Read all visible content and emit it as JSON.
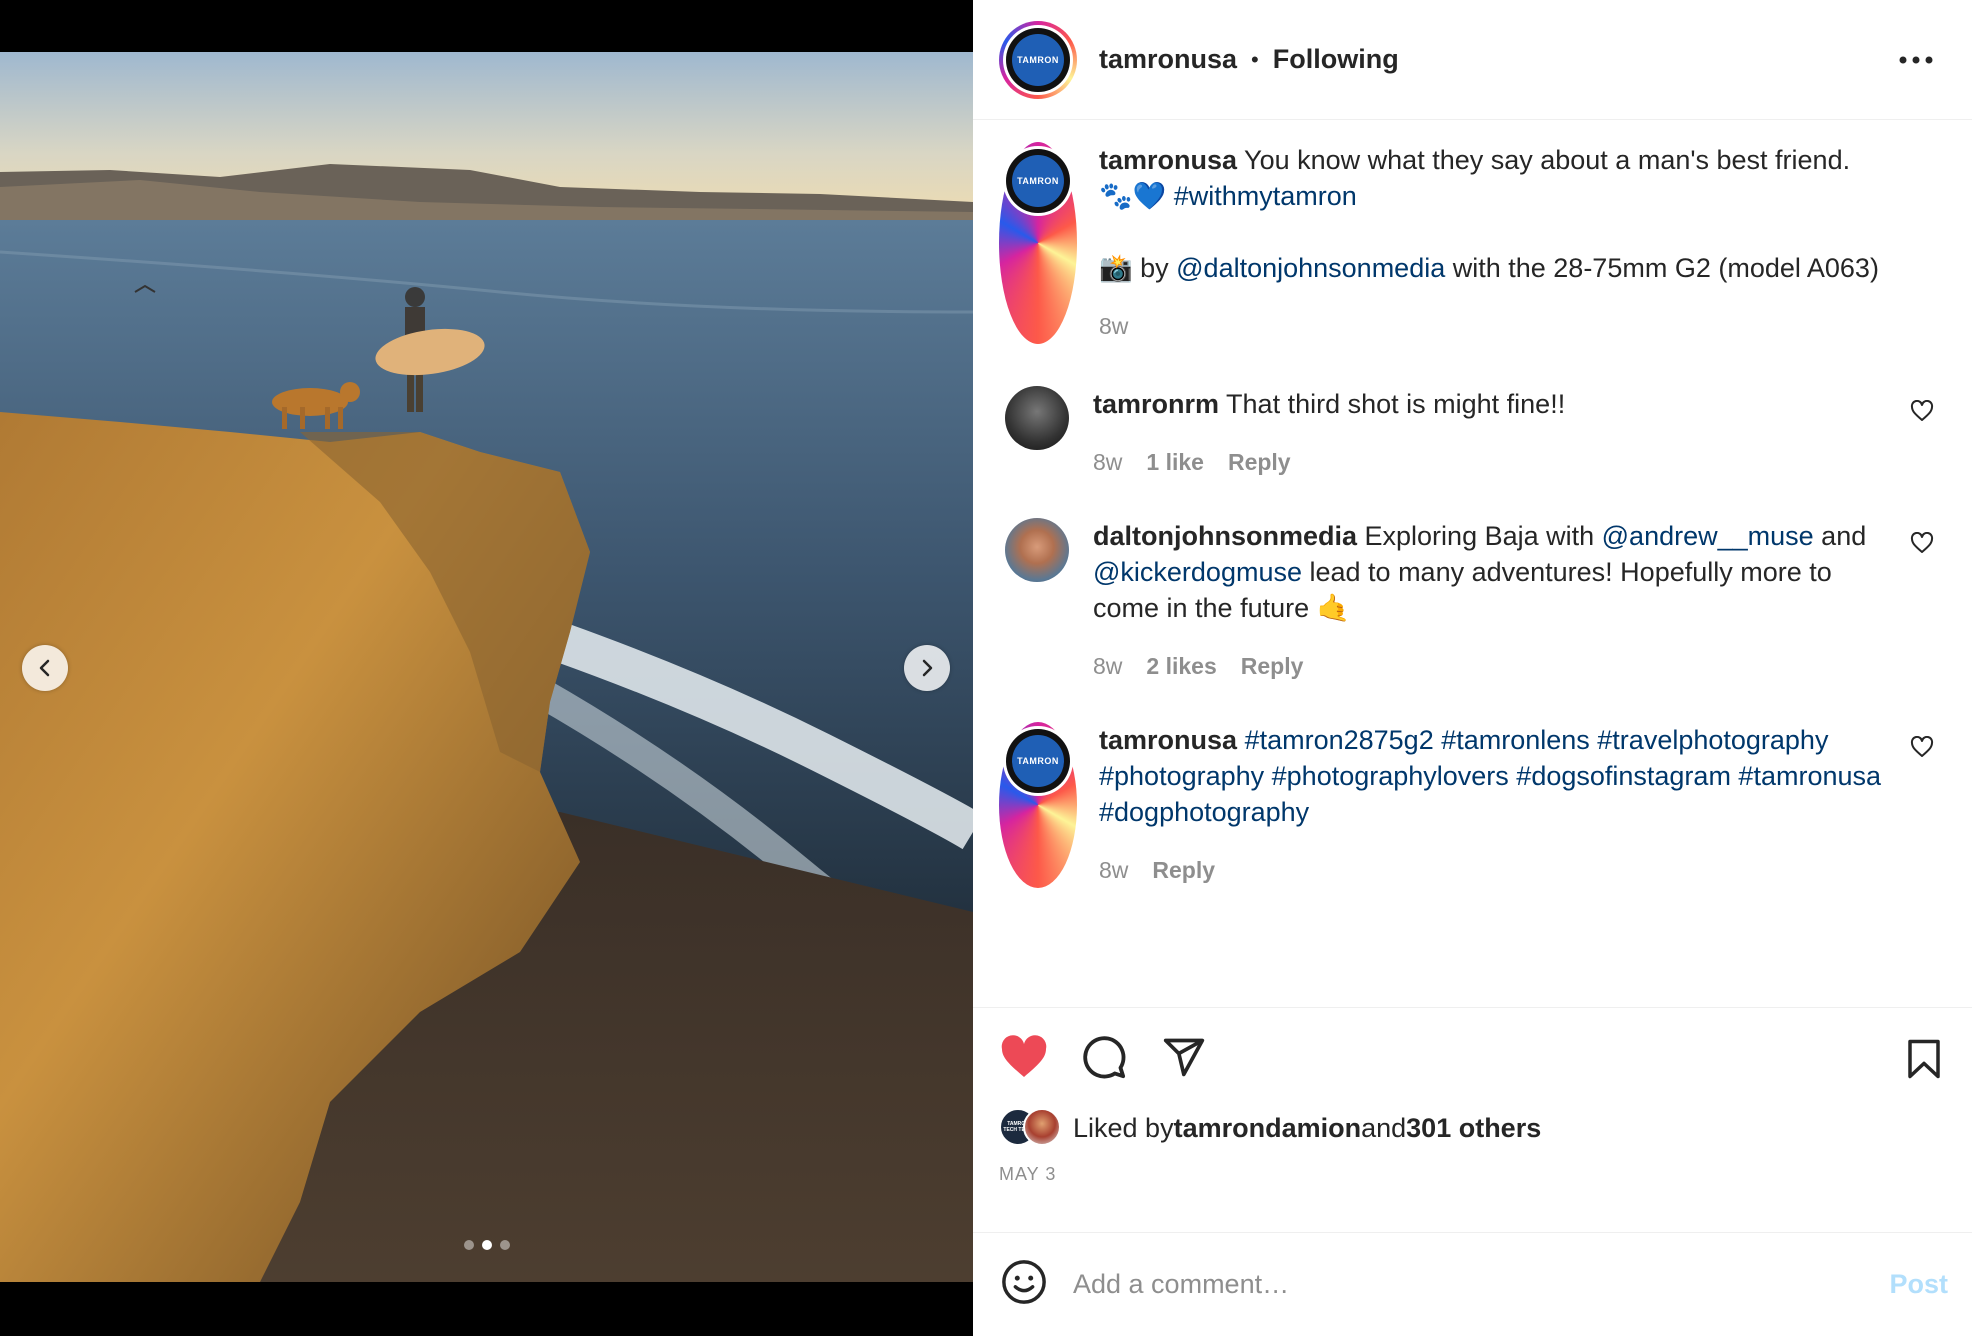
{
  "post": {
    "username": "tamronusa",
    "separator": "•",
    "follow_status": "Following",
    "avatar_text": "TAMRON"
  },
  "caption": {
    "username": "tamronusa",
    "text": " You know what they say about a man's best friend. 🐾💙 ",
    "hashtag": "#withmytamron",
    "credit_prefix": "📸 by ",
    "credit_mention": "@daltonjohnsonmedia",
    "credit_suffix": " with the 28-75mm G2 (model A063)",
    "time": "8w"
  },
  "comments": [
    {
      "username": "tamronrm",
      "text": " That third shot is might fine!!",
      "time": "8w",
      "likes": "1 like",
      "reply": "Reply"
    },
    {
      "username": "daltonjohnsonmedia",
      "text_1": " Exploring Baja with ",
      "mention_1": "@andrew__muse",
      "text_2": " and ",
      "mention_2": "@kickerdogmuse",
      "text_3": " lead to many adventures! Hopefully more to come in the future 🤙",
      "time": "8w",
      "likes": "2 likes",
      "reply": "Reply"
    },
    {
      "username": "tamronusa",
      "hashtags": "#tamron2875g2 #tamronlens #travelphotography #photography #photographylovers #dogsofinstagram #tamronusa #dogphotography",
      "time": "8w",
      "reply": "Reply"
    }
  ],
  "likes": {
    "prefix": "Liked by ",
    "user": "tamrondamion",
    "middle": " and ",
    "others": "301 others",
    "avatar_text": "TAMRON TECH TEAM"
  },
  "date": "MAY 3",
  "add_comment": {
    "placeholder": "Add a comment…",
    "post_label": "Post"
  },
  "carousel": {
    "count": 3,
    "active_index": 1
  },
  "colors": {
    "like_red": "#ed4956",
    "link_blue": "#00376b",
    "post_disabled": "#b2dffc",
    "tamron_blue": "#1f5fb5"
  },
  "icons": [
    "more-icon",
    "heart-icon",
    "comment-icon",
    "share-icon",
    "bookmark-icon",
    "emoji-icon",
    "chevron-left-icon",
    "chevron-right-icon"
  ]
}
